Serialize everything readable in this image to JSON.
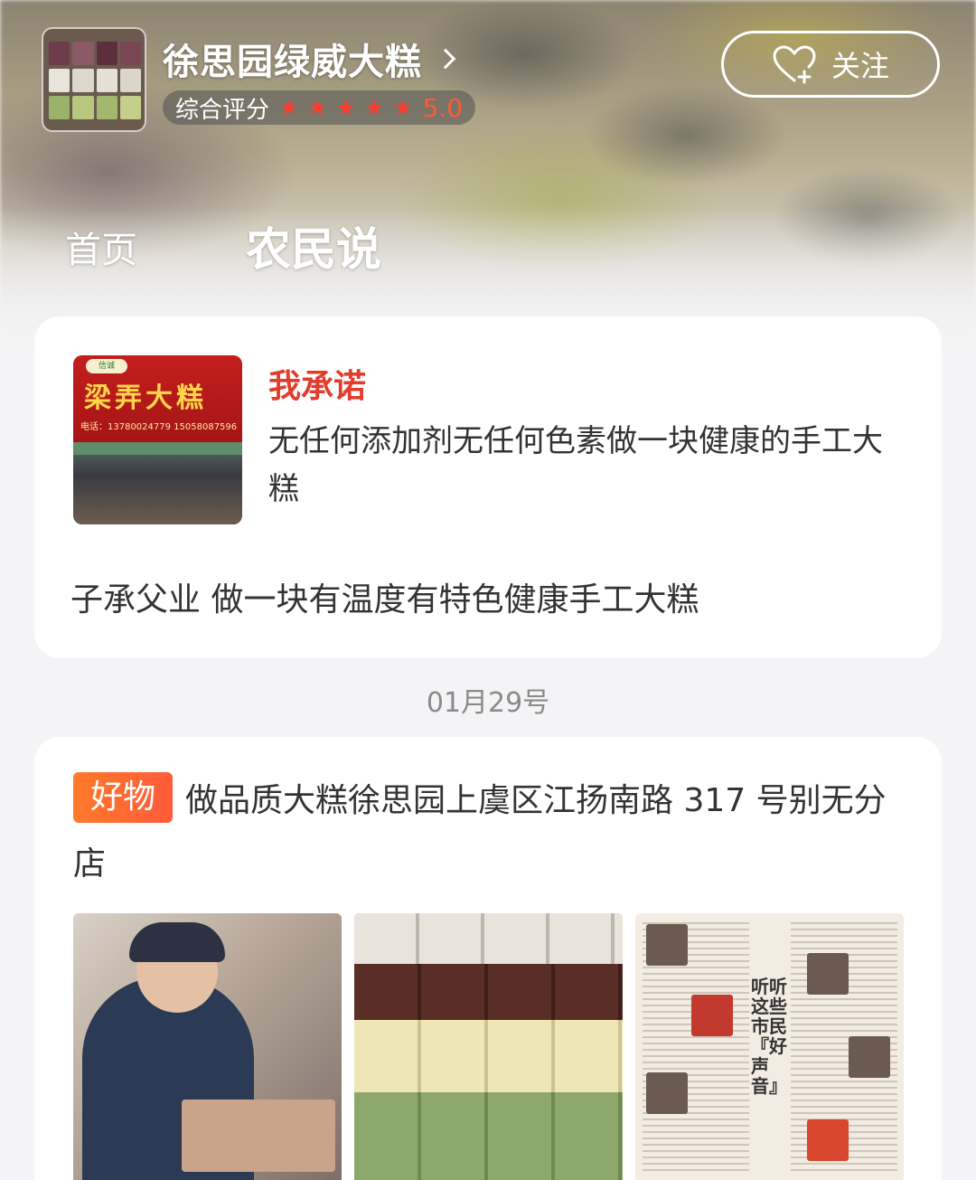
{
  "shop": {
    "name": "徐思园绿威大糕",
    "rating_label": "综合评分",
    "rating_stars": 5,
    "rating_score": "5.0",
    "follow_label": "关注"
  },
  "tabs": [
    {
      "label": "首页",
      "active": false
    },
    {
      "label": "农民说",
      "active": true
    }
  ],
  "promise_card": {
    "title": "我承诺",
    "text": "无任何添加剂无任何色素做一块健康的手工大糕",
    "description": "子承父业 做一块有温度有特色健康手工大糕",
    "thumb": {
      "sign_text": "梁弄大糕",
      "phone": "电话：13780024779 15058087596",
      "logo": "信诚"
    }
  },
  "date_label": "01月29号",
  "post": {
    "tag": "好物",
    "title": "做品质大糕徐思园上虞区江扬南路 317 号别无分店",
    "news_headline": "听听这些市民『好声音』"
  },
  "colors": {
    "accent_red": "#e23c2c",
    "star_red": "#ff3b30",
    "tag_orange": "#ff7a2a",
    "background": "#f4f4f6"
  }
}
